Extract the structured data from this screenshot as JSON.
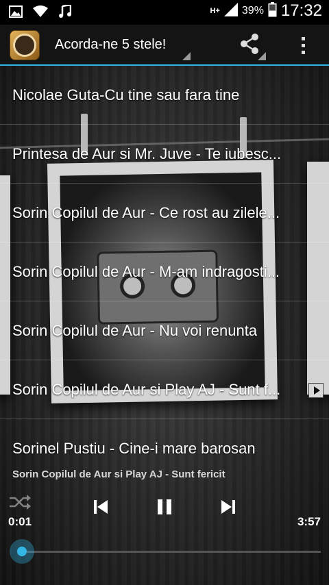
{
  "status_bar": {
    "icons": [
      "gallery-icon",
      "wifi-icon",
      "music-note-icon",
      "hplus-data-icon",
      "signal-icon",
      "battery-icon"
    ],
    "network_label": "H+",
    "battery": "39%",
    "clock": "17:32"
  },
  "action_bar": {
    "title": "Acorda-ne 5 stele!",
    "accent_color": "#33b5e5",
    "icons": [
      "app-logo-icon",
      "share-icon",
      "overflow-menu-icon"
    ]
  },
  "songs": [
    {
      "label": "Nicolae Guta-Cu tine sau fara tine"
    },
    {
      "label": "Printesa de Aur si Mr. Juve - Te iubesc..."
    },
    {
      "label": "Sorin Copilul de Aur - Ce rost au zilele..."
    },
    {
      "label": "Sorin Copilul de Aur - M-am indragosti..."
    },
    {
      "label": "Sorin Copilul de Aur - Nu voi renunta"
    },
    {
      "label": "Sorin Copilul de Aur si Play AJ - Sunt f..."
    },
    {
      "label": "Sorinel Pustiu - Cine-i mare barosan"
    }
  ],
  "player": {
    "now_playing": "Sorin Copilul de Aur si Play AJ - Sunt fericit",
    "elapsed": "0:01",
    "total": "3:57",
    "progress_fraction": 0.004,
    "controls": [
      "shuffle-icon",
      "previous-icon",
      "pause-icon",
      "next-icon"
    ]
  }
}
